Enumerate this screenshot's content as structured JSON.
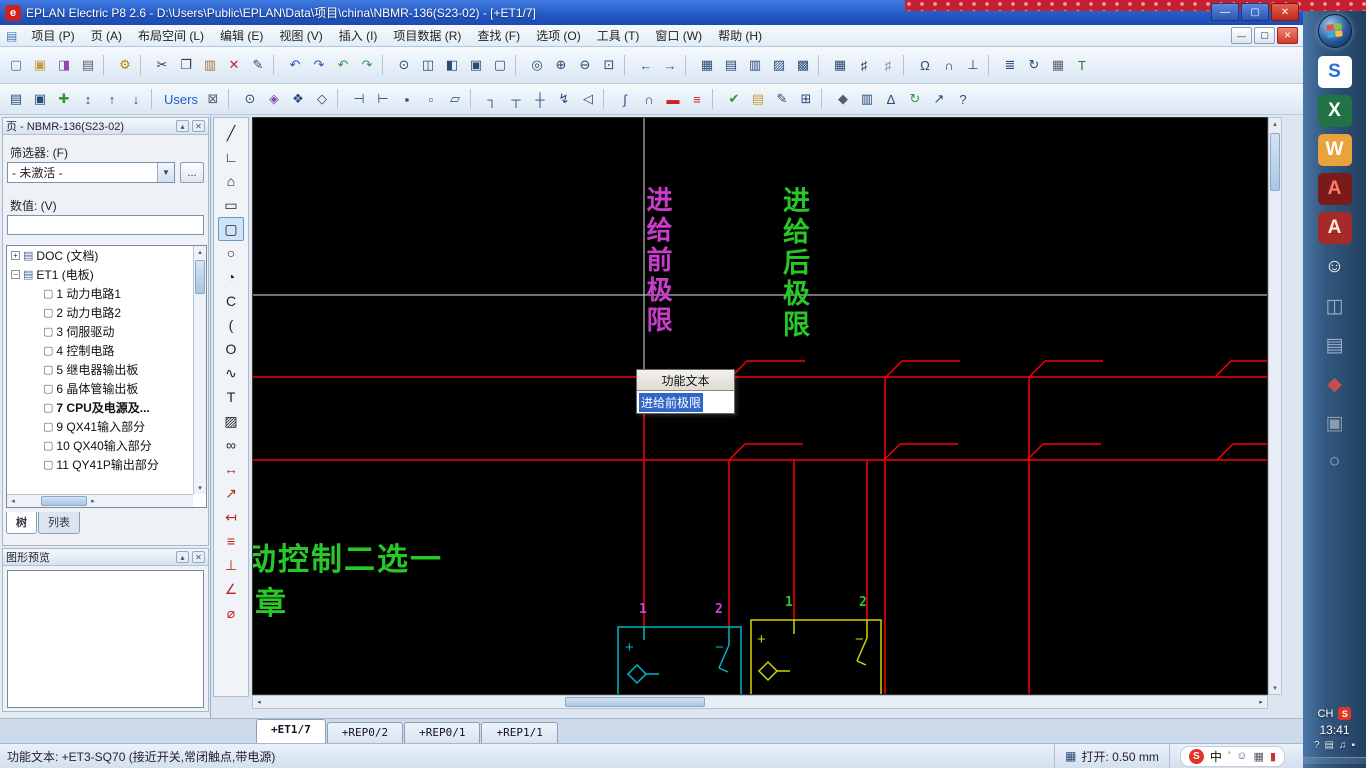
{
  "window": {
    "title": "EPLAN Electric P8 2.6 - D:\\Users\\Public\\EPLAN\\Data\\项目\\china\\NBMR-136(S23-02) - [+ET1/7]",
    "logo_glyph": "e",
    "controls": {
      "min": "—",
      "max": "▢",
      "close": "✕"
    }
  },
  "menu": {
    "mdi_icon": "▤",
    "items": [
      {
        "name": "menu-project",
        "label": "项目 (P)"
      },
      {
        "name": "menu-page",
        "label": "页 (A)"
      },
      {
        "name": "menu-layout-space",
        "label": "布局空间 (L)"
      },
      {
        "name": "menu-edit",
        "label": "编辑 (E)"
      },
      {
        "name": "menu-view",
        "label": "视图 (V)"
      },
      {
        "name": "menu-insert",
        "label": "插入 (I)"
      },
      {
        "name": "menu-project-data",
        "label": "项目数据 (R)"
      },
      {
        "name": "menu-find",
        "label": "查找 (F)"
      },
      {
        "name": "menu-options",
        "label": "选项 (O)"
      },
      {
        "name": "menu-tools",
        "label": "工具 (T)"
      },
      {
        "name": "menu-window",
        "label": "窗口 (W)"
      },
      {
        "name": "menu-help",
        "label": "帮助 (H)"
      }
    ],
    "mdi": {
      "min": "—",
      "restore": "▢",
      "close": "✕"
    }
  },
  "toolbar1": [
    {
      "name": "new-page-icon",
      "glyph": "▢",
      "color": "#3a6ca8"
    },
    {
      "name": "open-project-icon",
      "glyph": "▣",
      "color": "#c79b3c"
    },
    {
      "name": "page-macro-icon",
      "glyph": "◨",
      "color": "#8a4ab0"
    },
    {
      "name": "print-icon",
      "glyph": "▤",
      "color": "#55606e"
    },
    {
      "name": "separator",
      "sep": true
    },
    {
      "name": "settings-wrench-icon",
      "glyph": "⚙",
      "color": "#b8860b"
    },
    {
      "name": "separator",
      "sep": true
    },
    {
      "name": "cut-icon",
      "glyph": "✂",
      "color": "#333a4a"
    },
    {
      "name": "copy-icon",
      "glyph": "❐",
      "color": "#333a4a"
    },
    {
      "name": "paste-icon",
      "glyph": "▥",
      "color": "#a0713c"
    },
    {
      "name": "delete-icon",
      "glyph": "✕",
      "color": "#cc2222"
    },
    {
      "name": "format-brush-icon",
      "glyph": "✎",
      "color": "#2b4a77"
    },
    {
      "name": "separator",
      "sep": true
    },
    {
      "name": "undo-icon",
      "glyph": "↶",
      "color": "#2255bb"
    },
    {
      "name": "redo-icon",
      "glyph": "↷",
      "color": "#2255bb"
    },
    {
      "name": "undo-list-icon",
      "glyph": "↶",
      "color": "#2a9a4a"
    },
    {
      "name": "redo-list-icon",
      "glyph": "↷",
      "color": "#2a9a4a"
    },
    {
      "name": "separator",
      "sep": true
    },
    {
      "name": "insert-symbol-icon",
      "glyph": "⊙"
    },
    {
      "name": "graphic-preview-icon",
      "glyph": "◫"
    },
    {
      "name": "window-split-icon",
      "glyph": "◧"
    },
    {
      "name": "dialog-window-icon",
      "glyph": "▣"
    },
    {
      "name": "monitor-icon",
      "glyph": "▢"
    },
    {
      "name": "separator",
      "sep": true
    },
    {
      "name": "zoom-lens-icon",
      "glyph": "◎"
    },
    {
      "name": "zoom-in-icon",
      "glyph": "⊕"
    },
    {
      "name": "zoom-out-icon",
      "glyph": "⊖"
    },
    {
      "name": "zoom-window-icon",
      "glyph": "⊡"
    },
    {
      "name": "separator",
      "sep": true
    },
    {
      "name": "page-back-icon",
      "glyph": "←",
      "color": "#2060c8"
    },
    {
      "name": "page-forward-icon",
      "glyph": "→",
      "color": "#2060c8"
    },
    {
      "name": "separator",
      "sep": true
    },
    {
      "name": "grid-1-icon",
      "glyph": "▦"
    },
    {
      "name": "grid-2-icon",
      "glyph": "▤"
    },
    {
      "name": "grid-3-icon",
      "glyph": "▥"
    },
    {
      "name": "grid-4-icon",
      "glyph": "▨"
    },
    {
      "name": "grid-5-icon",
      "glyph": "▩"
    },
    {
      "name": "separator",
      "sep": true
    },
    {
      "name": "snap-grid-icon",
      "glyph": "▦"
    },
    {
      "name": "snap-on-icon",
      "glyph": "♯"
    },
    {
      "name": "snap-off-icon",
      "glyph": "♯",
      "color": "#8895a8"
    },
    {
      "name": "separator",
      "sep": true
    },
    {
      "name": "jump-symbol-icon",
      "glyph": "Ω"
    },
    {
      "name": "wire-arc-icon",
      "glyph": "∩"
    },
    {
      "name": "potential-track-icon",
      "glyph": "⊥"
    },
    {
      "name": "separator",
      "sep": true
    },
    {
      "name": "text-list-icon",
      "glyph": "≣"
    },
    {
      "name": "sync-icon",
      "glyph": "↻"
    },
    {
      "name": "table-view-icon",
      "glyph": "▦",
      "color": "#55606e"
    },
    {
      "name": "text-editor-icon",
      "glyph": "T",
      "color": "#1a7a3a"
    }
  ],
  "toolbar2": [
    {
      "name": "page-properties-icon",
      "glyph": "▤"
    },
    {
      "name": "page-navigator-icon",
      "glyph": "▣"
    },
    {
      "name": "new-item-icon",
      "glyph": "✚",
      "color": "#2a9a2a"
    },
    {
      "name": "sort-icon",
      "glyph": "↕"
    },
    {
      "name": "filter-up-icon",
      "glyph": "↑"
    },
    {
      "name": "filter-down-icon",
      "glyph": "↓"
    },
    {
      "name": "separator",
      "sep": true
    },
    {
      "name": "users-icon",
      "glyph": "Users",
      "color": "#2060c8"
    },
    {
      "name": "lock-icon",
      "glyph": "⊠",
      "color": "#55606e"
    },
    {
      "name": "separator",
      "sep": true
    },
    {
      "name": "symbol-insert-icon",
      "glyph": "⊙"
    },
    {
      "name": "macro-box-icon",
      "glyph": "◈",
      "color": "#8a4ab0"
    },
    {
      "name": "window-macro-icon",
      "glyph": "❖"
    },
    {
      "name": "page-macro-2-icon",
      "glyph": "◇"
    },
    {
      "name": "separator",
      "sep": true
    },
    {
      "name": "terminal-strip-icon",
      "glyph": "⊣"
    },
    {
      "name": "plug-icon",
      "glyph": "⊢"
    },
    {
      "name": "black-box-icon",
      "glyph": "▪"
    },
    {
      "name": "plc-box-icon",
      "glyph": "▫"
    },
    {
      "name": "structure-box-icon",
      "glyph": "▱"
    },
    {
      "name": "separator",
      "sep": true
    },
    {
      "name": "connection-corner-icon",
      "glyph": "┐"
    },
    {
      "name": "t-node-icon",
      "glyph": "┬"
    },
    {
      "name": "cross-node-icon",
      "glyph": "┼"
    },
    {
      "name": "jump-point-icon",
      "glyph": "↯"
    },
    {
      "name": "interruption-point-icon",
      "glyph": "◁"
    },
    {
      "name": "separator",
      "sep": true
    },
    {
      "name": "cable-definition-icon",
      "glyph": "∫"
    },
    {
      "name": "shield-icon",
      "glyph": "∩"
    },
    {
      "name": "busbar-icon",
      "glyph": "▬",
      "color": "#cc2222"
    },
    {
      "name": "phase-bar-icon",
      "glyph": "≡",
      "color": "#cc2222"
    },
    {
      "name": "separator",
      "sep": true
    },
    {
      "name": "check-project-icon",
      "glyph": "✔",
      "color": "#2a9a2a"
    },
    {
      "name": "message-management-icon",
      "glyph": "▤",
      "color": "#c79b3c"
    },
    {
      "name": "edit-properties-icon",
      "glyph": "✎"
    },
    {
      "name": "device-data-icon",
      "glyph": "⊞"
    },
    {
      "name": "separator",
      "sep": true
    },
    {
      "name": "part-icon",
      "glyph": "◆",
      "color": "#55606e"
    },
    {
      "name": "report-icon",
      "glyph": "▥"
    },
    {
      "name": "revision-icon",
      "glyph": "Δ"
    },
    {
      "name": "update-icon",
      "glyph": "↻",
      "color": "#2a9a4a"
    },
    {
      "name": "external-link-icon",
      "glyph": "↗"
    },
    {
      "name": "help-question-icon",
      "glyph": "?"
    }
  ],
  "draw_tools": [
    {
      "name": "line-icon",
      "glyph": "╱"
    },
    {
      "name": "polyline-icon",
      "glyph": "∟"
    },
    {
      "name": "polygon-icon",
      "glyph": "⌂"
    },
    {
      "name": "rectangle-icon",
      "glyph": "▭"
    },
    {
      "name": "rectangle-2point-icon",
      "glyph": "▢",
      "active": true
    },
    {
      "name": "circle-icon",
      "glyph": "○"
    },
    {
      "name": "circle-sector-icon",
      "glyph": "◔"
    },
    {
      "name": "arc-icon",
      "glyph": "C"
    },
    {
      "name": "arc-3point-icon",
      "glyph": "("
    },
    {
      "name": "ellipse-icon",
      "glyph": "O"
    },
    {
      "name": "spline-icon",
      "glyph": "∿"
    },
    {
      "name": "text-icon",
      "glyph": "T"
    },
    {
      "name": "image-icon",
      "glyph": "▨"
    },
    {
      "name": "hyperlink-icon",
      "glyph": "∞"
    },
    {
      "name": "dimension-icon",
      "glyph": "↔",
      "color": "#c22020"
    },
    {
      "name": "dimension-continued-icon",
      "glyph": "↗",
      "color": "#c22020"
    },
    {
      "name": "dimension-baseline-icon",
      "glyph": "↤",
      "color": "#c22020"
    },
    {
      "name": "dimension-increment-icon",
      "glyph": "≡",
      "color": "#c22020"
    },
    {
      "name": "dimension-perpendicular-icon",
      "glyph": "⊥",
      "color": "#c22020"
    },
    {
      "name": "dimension-angle-icon",
      "glyph": "∠",
      "color": "#c22020"
    },
    {
      "name": "dimension-radius-icon",
      "glyph": "⌀",
      "color": "#c22020"
    }
  ],
  "pages_panel": {
    "title": "页 - NBMR-136(S23-02)",
    "pin": "▴",
    "close": "✕",
    "filter_label": "筛选器: (F)",
    "filter_value": "- 未激活 -",
    "dropdown_arrow": "▼",
    "browse": "...",
    "value_label": "数值: (V)",
    "value_text": "",
    "tree": [
      {
        "name": "tree-item-doc",
        "indent": 4,
        "expander": "+",
        "icon": "▤",
        "label": "DOC (文档)"
      },
      {
        "name": "tree-item-et1",
        "indent": 4,
        "expander": "−",
        "icon": "▤",
        "label": "ET1 (电板)"
      },
      {
        "name": "tree-item-1",
        "indent": 24,
        "expander": "",
        "icon": "▢",
        "label": "1 动力电路1"
      },
      {
        "name": "tree-item-2",
        "indent": 24,
        "expander": "",
        "icon": "▢",
        "label": "2 动力电路2"
      },
      {
        "name": "tree-item-3",
        "indent": 24,
        "expander": "",
        "icon": "▢",
        "label": "3 伺服驱动"
      },
      {
        "name": "tree-item-4",
        "indent": 24,
        "expander": "",
        "icon": "▢",
        "label": "4 控制电路"
      },
      {
        "name": "tree-item-5",
        "indent": 24,
        "expander": "",
        "icon": "▢",
        "label": "5 继电器输出板"
      },
      {
        "name": "tree-item-6",
        "indent": 24,
        "expander": "",
        "icon": "▢",
        "label": "6 晶体管输出板"
      },
      {
        "name": "tree-item-7",
        "indent": 24,
        "expander": "",
        "icon": "▢",
        "label": "7 CPU及电源及...",
        "bold": true
      },
      {
        "name": "tree-item-9",
        "indent": 24,
        "expander": "",
        "icon": "▢",
        "label": "9 QX41输入部分"
      },
      {
        "name": "tree-item-10",
        "indent": 24,
        "expander": "",
        "icon": "▢",
        "label": "10 QX40输入部分"
      },
      {
        "name": "tree-item-11",
        "indent": 24,
        "expander": "",
        "icon": "▢",
        "label": "11 QY41P输出部分"
      }
    ],
    "tabs": [
      {
        "name": "tab-tree",
        "label": "树",
        "active": true
      },
      {
        "name": "tab-list",
        "label": "列表"
      }
    ]
  },
  "preview_panel": {
    "title": "图形预览",
    "pin": "▴",
    "close": "✕"
  },
  "scrollbars": {
    "up": "▴",
    "down": "▾",
    "left": "◂",
    "right": "▸"
  },
  "canvas": {
    "vertical_text_1": "进给前极限",
    "vertical_text_2": "进给后极限",
    "vt1_color": "#cc3ccc",
    "vt2_color": "#28c828",
    "big_text_line1": "动控制二选一",
    "big_text_line2": "章",
    "popup": {
      "title": "功能文本",
      "value": "进给前极限"
    },
    "box1": {
      "t1": "1",
      "t2": "2",
      "plus": "+",
      "minus": "−",
      "color": "#00b8c8"
    },
    "box2": {
      "t1": "1",
      "t2": "2",
      "plus": "+",
      "minus": "−",
      "color": "#d4d400"
    }
  },
  "sheet_tabs": [
    {
      "name": "sheet-tab-et1-7",
      "label": "+ET1/7",
      "active": true
    },
    {
      "name": "sheet-tab-rep0-2",
      "label": "+REP0/2"
    },
    {
      "name": "sheet-tab-rep0-1",
      "label": "+REP0/1"
    },
    {
      "name": "sheet-tab-rep1-1",
      "label": "+REP1/1"
    }
  ],
  "status_bar": {
    "left": "功能文本: +ET3-SQ70 (接近开关,常闭触点,带电源)",
    "grid_icon": "▦",
    "grid": "打开: 0.50 mm",
    "ime_logo": "S",
    "ime_lang": "中",
    "ime_icons": [
      {
        "name": "ime-mode-icon",
        "glyph": "’"
      },
      {
        "name": "ime-emoji-icon",
        "glyph": "☺"
      },
      {
        "name": "ime-keyboard-icon",
        "glyph": "▦"
      },
      {
        "name": "ime-skin-icon",
        "glyph": "▮",
        "color": "#cc3333"
      }
    ]
  },
  "taskbar": {
    "apps": [
      {
        "name": "sogou-input-icon",
        "glyph": "S",
        "bg": "#ffffff",
        "color": "#2a6fd8"
      },
      {
        "name": "excel-icon",
        "glyph": "X",
        "bg": "#217346",
        "color": "#ffffff"
      },
      {
        "name": "wps-icon",
        "glyph": "W",
        "bg": "#e8a33d",
        "color": "#ffffff"
      },
      {
        "name": "autocad-icon",
        "glyph": "A",
        "bg": "#7a1a1a",
        "color": "#ff7b6e"
      },
      {
        "name": "autocad-classic-icon",
        "glyph": "A",
        "bg": "#a52a2a",
        "color": "#ffe8d8"
      },
      {
        "name": "chat-icon",
        "glyph": "☺",
        "bg": "transparent",
        "color": "#f0f4f8"
      },
      {
        "name": "app-gray-1-icon",
        "glyph": "◫",
        "bg": "transparent",
        "color": "#9ab0c8"
      },
      {
        "name": "app-gray-2-icon",
        "glyph": "▤",
        "bg": "transparent",
        "color": "#9ab0c8"
      },
      {
        "name": "app-red-icon",
        "glyph": "◆",
        "bg": "transparent",
        "color": "#c05050"
      },
      {
        "name": "app-gray-3-icon",
        "glyph": "▣",
        "bg": "transparent",
        "color": "#8a9ab0"
      },
      {
        "name": "app-gray-4-icon",
        "glyph": "○",
        "bg": "transparent",
        "color": "#9ab0c8"
      }
    ],
    "lang": "CH",
    "tray_badge": "S",
    "clock": "13:41",
    "tray_icons": [
      {
        "name": "help-tray-icon",
        "glyph": "?"
      },
      {
        "name": "folder-tray-icon",
        "glyph": "▤"
      },
      {
        "name": "volume-icon",
        "glyph": "♫"
      },
      {
        "name": "network-icon",
        "glyph": "▪"
      }
    ]
  }
}
